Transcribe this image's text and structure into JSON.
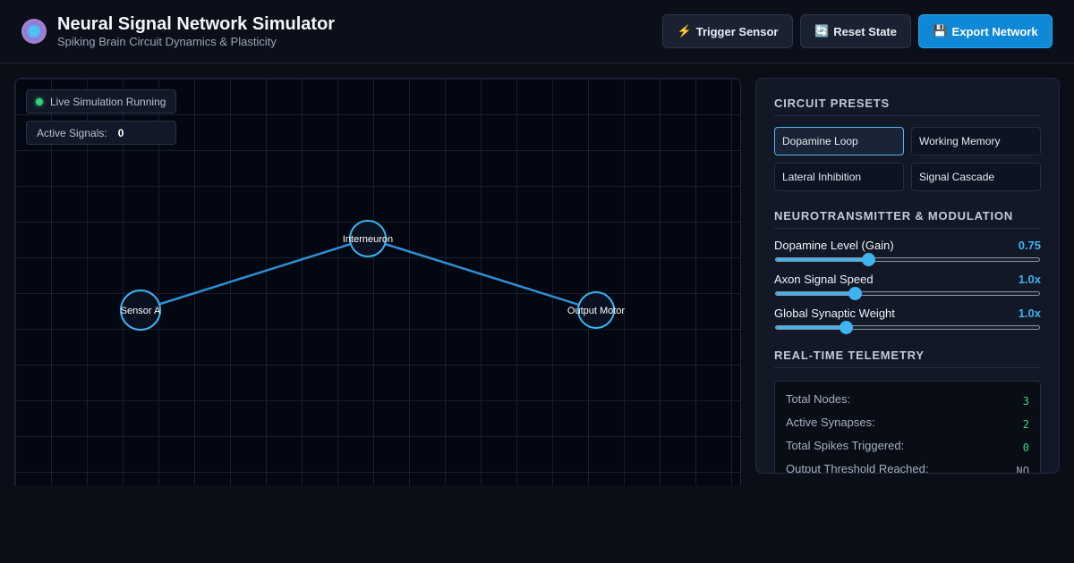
{
  "header": {
    "title": "Neural Signal Network Simulator",
    "subtitle": "Spiking Brain Circuit Dynamics & Plasticity",
    "buttons": {
      "trigger": {
        "icon": "⚡",
        "label": "Trigger Sensor"
      },
      "reset": {
        "icon": "🔄",
        "label": "Reset State"
      },
      "export": {
        "icon": "💾",
        "label": "Export Network"
      }
    }
  },
  "canvas": {
    "status": "Live Simulation Running",
    "signals_label": "Active Signals:",
    "signals_value": "0",
    "nodes": [
      {
        "id": "sensor",
        "label": "Sensor A"
      },
      {
        "id": "inter",
        "label": "Interneuron"
      },
      {
        "id": "output",
        "label": "Output Motor"
      }
    ]
  },
  "panel": {
    "presets_title": "CIRCUIT PRESETS",
    "presets": [
      {
        "label": "Dopamine Loop",
        "active": true
      },
      {
        "label": "Working Memory",
        "active": false
      },
      {
        "label": "Lateral Inhibition",
        "active": false
      },
      {
        "label": "Signal Cascade",
        "active": false
      }
    ],
    "modulation_title": "NEUROTRANSMITTER & MODULATION",
    "sliders": [
      {
        "label": "Dopamine Level (Gain)",
        "value": "0.75",
        "fraction": 0.35
      },
      {
        "label": "Axon Signal Speed",
        "value": "1.0x",
        "fraction": 0.3
      },
      {
        "label": "Global Synaptic Weight",
        "value": "1.0x",
        "fraction": 0.265
      }
    ],
    "telemetry_title": "REAL-TIME TELEMETRY",
    "telemetry": [
      {
        "label": "Total Nodes:",
        "value": "3"
      },
      {
        "label": "Active Synapses:",
        "value": "2"
      },
      {
        "label": "Total Spikes Triggered:",
        "value": "0"
      },
      {
        "label": "Output Threshold Reached:",
        "value": "NO"
      }
    ]
  },
  "colors": {
    "accent": "#3fb4f0",
    "primary_button": "#0f89d6",
    "status_green": "#34d27b"
  }
}
